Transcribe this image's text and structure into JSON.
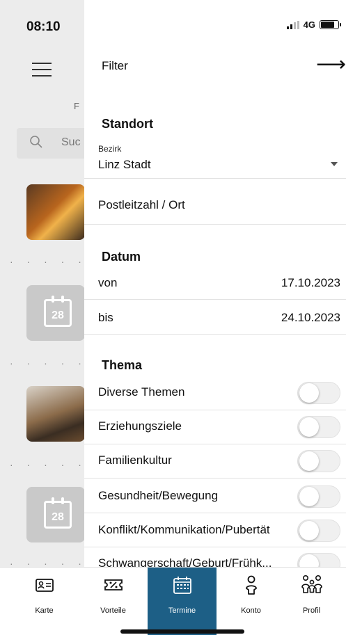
{
  "status_bar": {
    "time": "08:10",
    "network": "4G"
  },
  "background": {
    "tab_peek": "F",
    "search_placeholder": "Suc",
    "calendar_day": "28"
  },
  "drawer": {
    "title": "Filter",
    "close_icon": "arrow-right-icon",
    "standort": {
      "title": "Standort",
      "bezirk_label": "Bezirk",
      "bezirk_value": "Linz Stadt",
      "plz_label": "Postleitzahl / Ort"
    },
    "datum": {
      "title": "Datum",
      "von_label": "von",
      "von_value": "17.10.2023",
      "bis_label": "bis",
      "bis_value": "24.10.2023"
    },
    "thema": {
      "title": "Thema",
      "items": [
        {
          "label": "Diverse Themen",
          "on": false
        },
        {
          "label": "Erziehungsziele",
          "on": false
        },
        {
          "label": "Familienkultur",
          "on": false
        },
        {
          "label": "Gesundheit/Bewegung",
          "on": false
        },
        {
          "label": "Konflikt/Kommunikation/Pubertät",
          "on": false
        },
        {
          "label": "Schwangerschaft/Geburt/Frühk...",
          "on": false
        }
      ]
    }
  },
  "bottom_nav": {
    "active_color": "#1d5f86",
    "items": [
      {
        "label": "Karte",
        "icon": "id-card-icon"
      },
      {
        "label": "Vorteile",
        "icon": "ticket-percent-icon"
      },
      {
        "label": "Termine",
        "icon": "calendar-icon"
      },
      {
        "label": "Konto",
        "icon": "user-icon"
      },
      {
        "label": "Profil",
        "icon": "family-icon"
      }
    ]
  }
}
